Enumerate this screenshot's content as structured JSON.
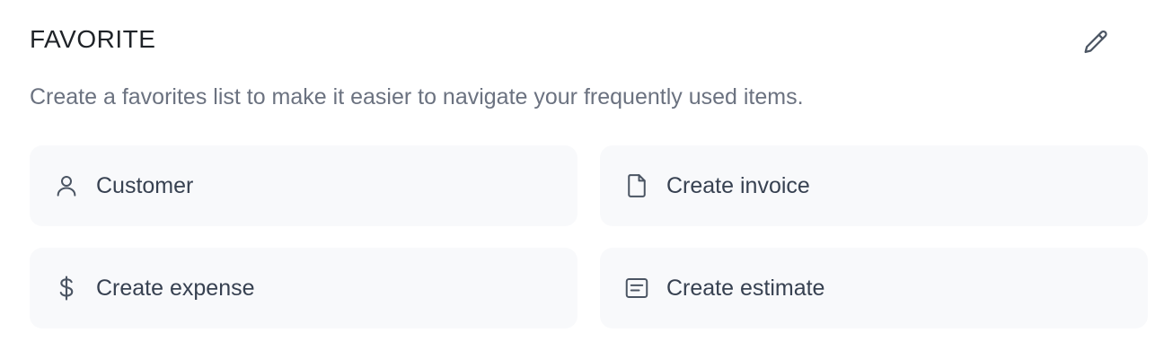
{
  "section": {
    "title": "FAVORITE",
    "description": "Create a favorites list to make it easier to navigate your frequently used items.",
    "edit_icon": "pencil-icon"
  },
  "favorites": [
    {
      "label": "Customer",
      "icon": "user-icon"
    },
    {
      "label": "Create invoice",
      "icon": "document-icon"
    },
    {
      "label": "Create expense",
      "icon": "dollar-icon"
    },
    {
      "label": "Create estimate",
      "icon": "estimate-icon"
    }
  ],
  "colors": {
    "card_background": "#f8f9fb",
    "icon": "#4b5563",
    "text": "#374151",
    "muted": "#6b7280"
  }
}
